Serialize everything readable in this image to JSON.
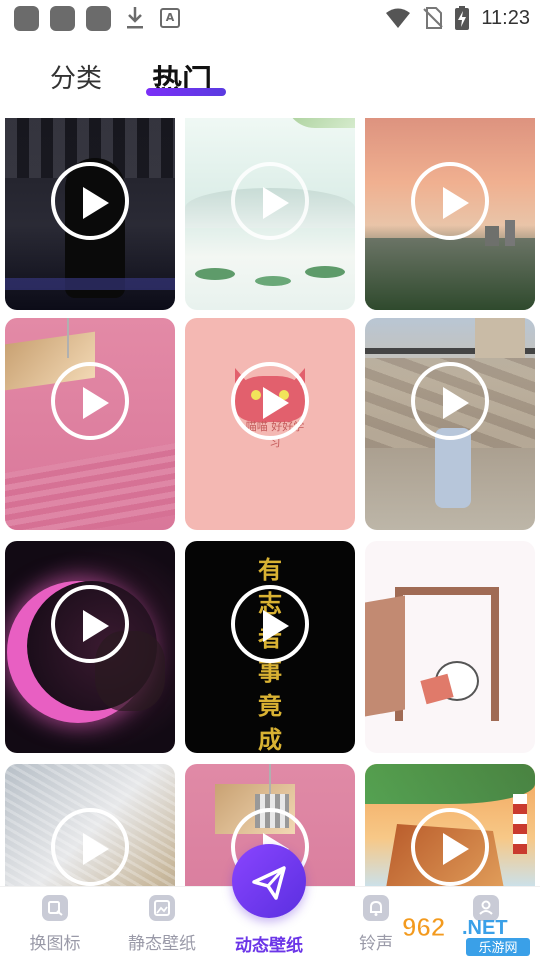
{
  "status_bar": {
    "time": "11:23",
    "icons": [
      "app-icon",
      "app-icon",
      "app-icon",
      "download-icon",
      "a-icon",
      "wifi-icon",
      "no-sim-icon",
      "battery-charging-icon"
    ]
  },
  "tabs": [
    {
      "label": "分类",
      "active": false
    },
    {
      "label": "热门",
      "active": true
    }
  ],
  "cards": [
    {
      "name": "dancer-video"
    },
    {
      "name": "lotus-landscape-video"
    },
    {
      "name": "sunset-city-video"
    },
    {
      "name": "pink-cube-video"
    },
    {
      "name": "pink-cat-video",
      "caption": "喵喵 好好学习"
    },
    {
      "name": "street-dance-video"
    },
    {
      "name": "crescent-moon-video"
    },
    {
      "name": "calligraphy-video",
      "text": "有志者事竟成"
    },
    {
      "name": "door-cartoon-video"
    },
    {
      "name": "fur-video"
    },
    {
      "name": "pink-cube-video-2"
    },
    {
      "name": "sailing-ship-video"
    }
  ],
  "bottom_nav": [
    {
      "label": "换图标",
      "icon": "change-icon-icon",
      "active": false
    },
    {
      "label": "静态壁纸",
      "icon": "static-wallpaper-icon",
      "active": false
    },
    {
      "label": "动态壁纸",
      "icon": "paper-plane-icon",
      "active": true
    },
    {
      "label": "铃声",
      "icon": "bell-icon",
      "active": false
    },
    {
      "label": "",
      "icon": "profile-icon",
      "active": false
    }
  ],
  "watermark": {
    "number": "962",
    "suffix": ".NET",
    "subtitle": "乐游网"
  },
  "colors": {
    "accent": "#6b35e8",
    "inactive": "#9a9aa8"
  }
}
